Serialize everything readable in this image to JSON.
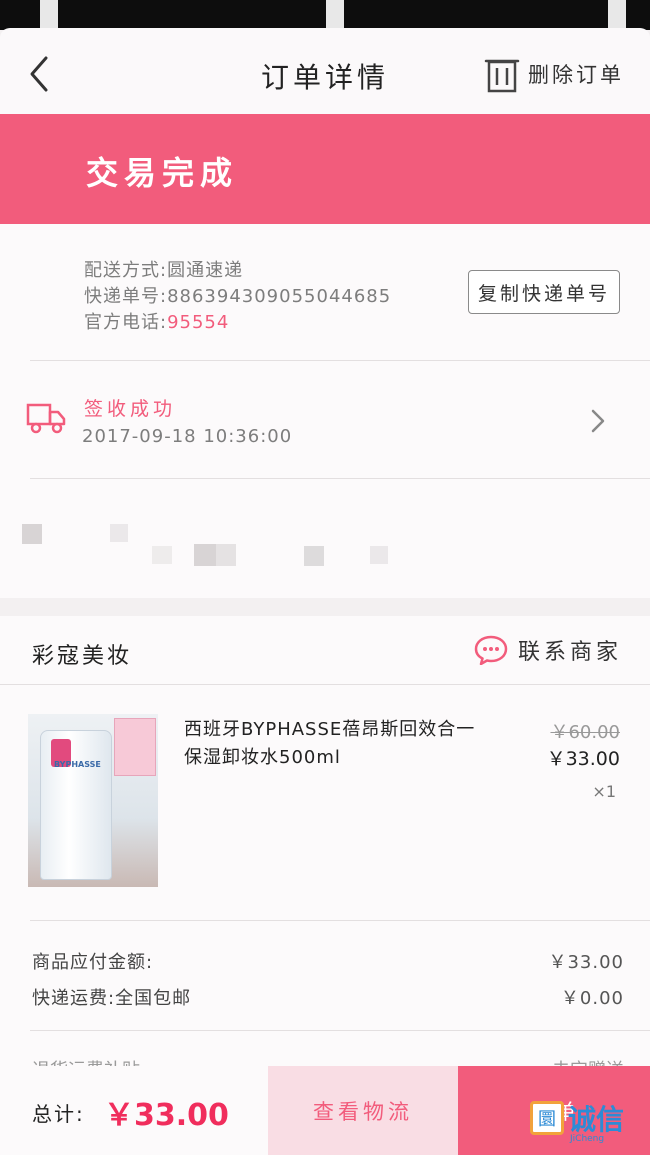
{
  "nav": {
    "title": "订单详情",
    "delete_label": "删除订单"
  },
  "status": {
    "text": "交易完成"
  },
  "shipping": {
    "method": "配送方式:圆通速递",
    "tracking_no": "快递单号:886394309055044685",
    "phone_label": "官方电话:",
    "phone": "95554",
    "copy_button": "复制快递单号"
  },
  "tracking": {
    "status": "签收成功",
    "time": "2017-09-18 10:36:00"
  },
  "shop": {
    "name": "彩寇美妆",
    "contact_label": "联系商家"
  },
  "product": {
    "title": "西班牙BYPHASSE蓓昂斯回效合一保湿卸妆水500ml",
    "original_price": "￥60.00",
    "price": "￥33.00",
    "quantity": "×1",
    "image_brand": "BYPHASSE"
  },
  "summary": {
    "goods_label": "商品应付金额:",
    "goods_value": "￥33.00",
    "shipping_label": "快递运费:全国包邮",
    "shipping_value": "￥0.00",
    "partial_left": "退货运费补贴",
    "partial_right": "未宝赠送"
  },
  "footer": {
    "total_label": "总计:",
    "total_value": "￥33.00",
    "logistics_button": "查看物流",
    "confirm_button": "晒单"
  },
  "watermark": {
    "icon_glyph": "圜",
    "text": "诚信",
    "sub": "JiCheng"
  },
  "colors": {
    "accent": "#f25c7c",
    "price_red": "#f02d5c",
    "banner": "#f25c7c"
  }
}
